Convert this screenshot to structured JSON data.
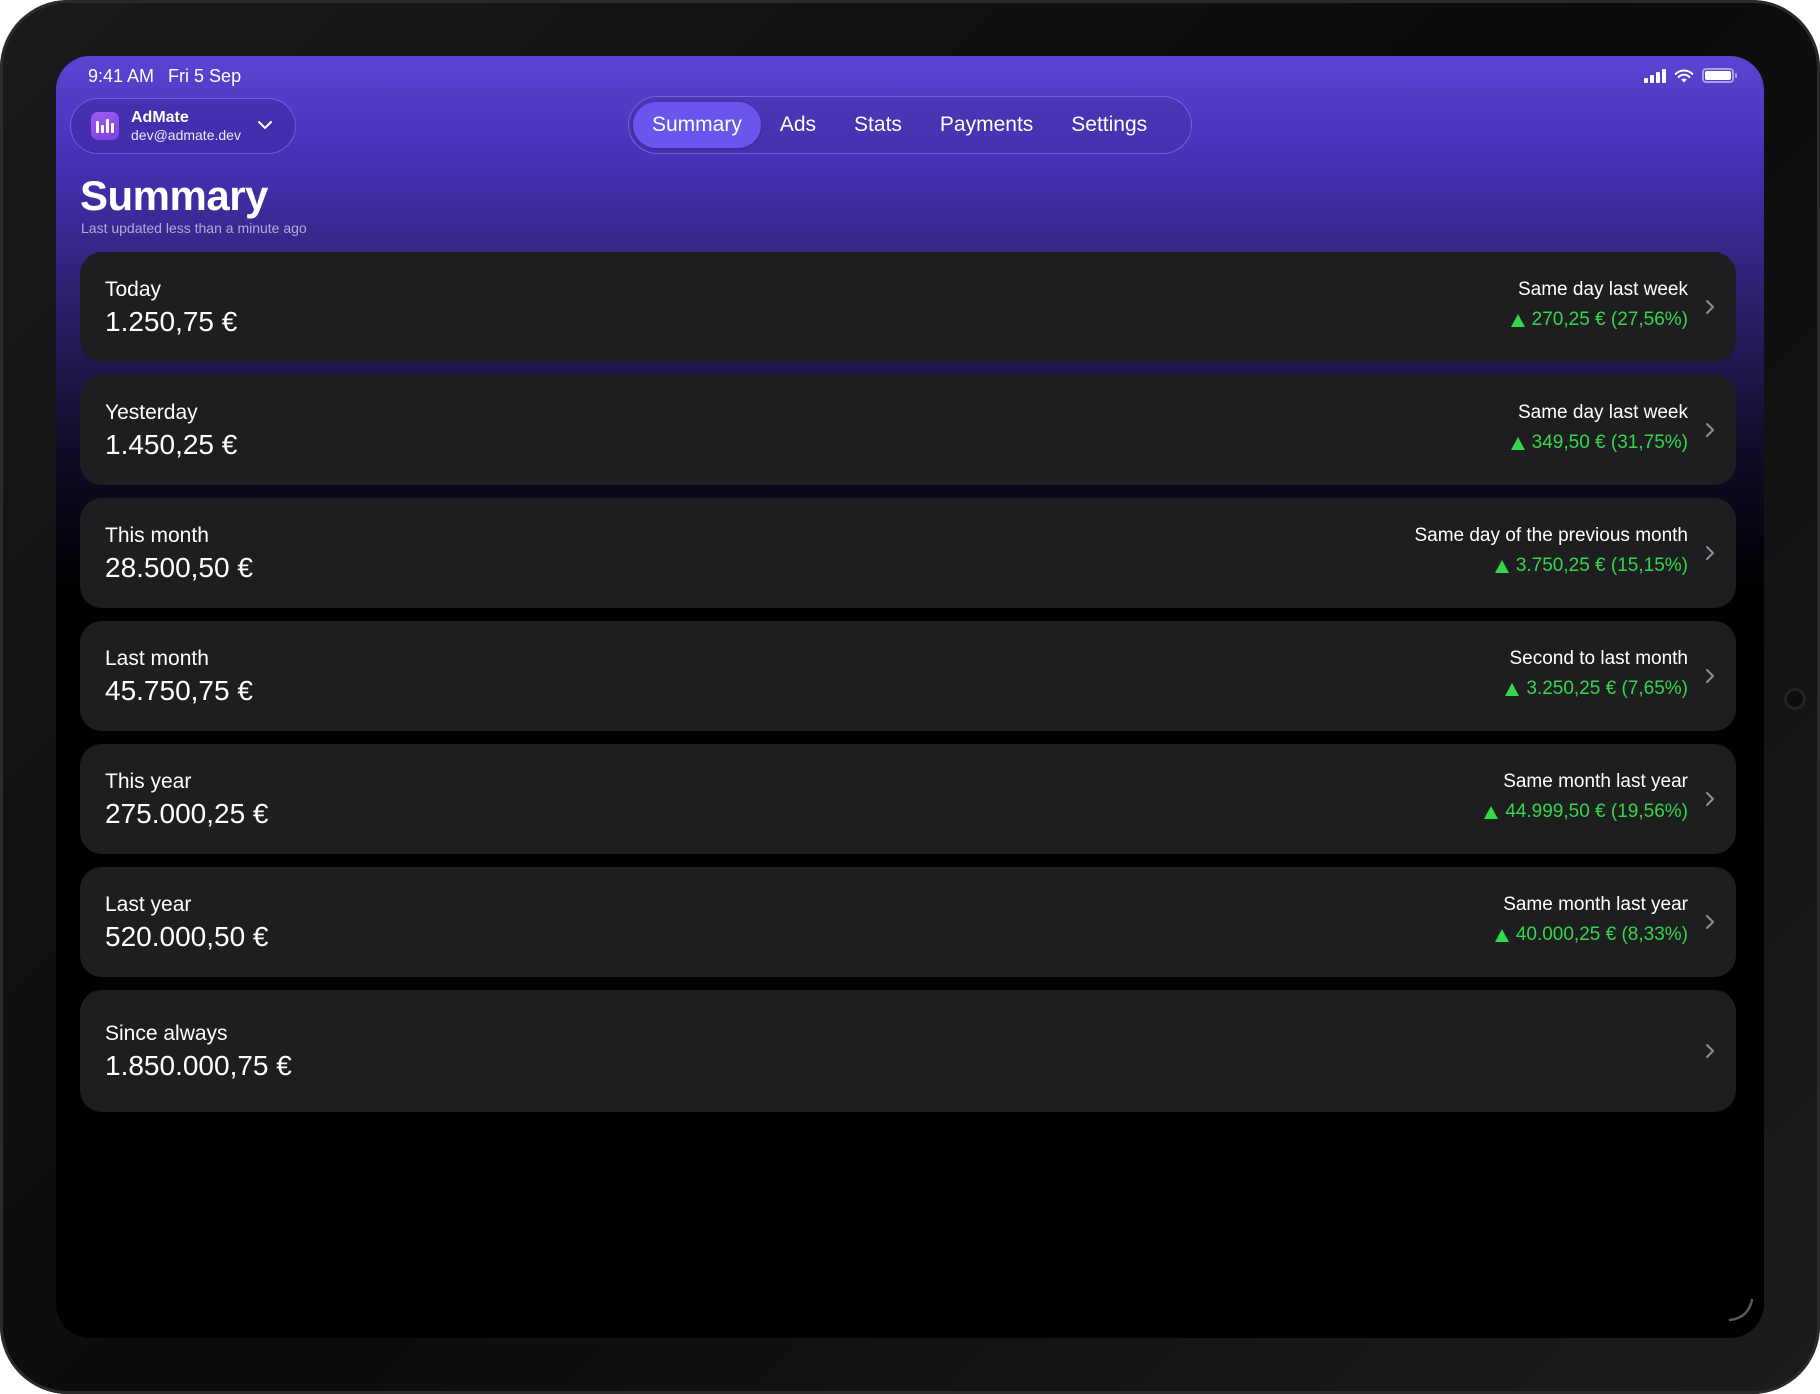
{
  "status_bar": {
    "time": "9:41 AM",
    "date": "Fri 5 Sep"
  },
  "account": {
    "name": "AdMate",
    "email": "dev@admate.dev"
  },
  "tabs": [
    {
      "label": "Summary",
      "active": true
    },
    {
      "label": "Ads",
      "active": false
    },
    {
      "label": "Stats",
      "active": false
    },
    {
      "label": "Payments",
      "active": false
    },
    {
      "label": "Settings",
      "active": false
    }
  ],
  "header": {
    "title": "Summary",
    "subtitle": "Last updated less than a minute ago"
  },
  "cards": [
    {
      "label": "Today",
      "value": "1.250,75 €",
      "compare": "Same day last week",
      "delta": "270,25 € (27,56%)",
      "trend": "up"
    },
    {
      "label": "Yesterday",
      "value": "1.450,25 €",
      "compare": "Same day last week",
      "delta": "349,50 € (31,75%)",
      "trend": "up"
    },
    {
      "label": "This month",
      "value": "28.500,50 €",
      "compare": "Same day of the previous month",
      "delta": "3.750,25 € (15,15%)",
      "trend": "up"
    },
    {
      "label": "Last month",
      "value": "45.750,75 €",
      "compare": "Second to last month",
      "delta": "3.250,25 € (7,65%)",
      "trend": "up"
    },
    {
      "label": "This year",
      "value": "275.000,25 €",
      "compare": "Same month last year",
      "delta": "44.999,50 € (19,56%)",
      "trend": "up"
    },
    {
      "label": "Last year",
      "value": "520.000,50 €",
      "compare": "Same month last year",
      "delta": "40.000,25 € (8,33%)",
      "trend": "up"
    },
    {
      "label": "Since always",
      "value": "1.850.000,75 €"
    }
  ],
  "colors": {
    "accent": "#6a55ee",
    "positive": "#32d74b",
    "card_background": "#1e1e20"
  }
}
